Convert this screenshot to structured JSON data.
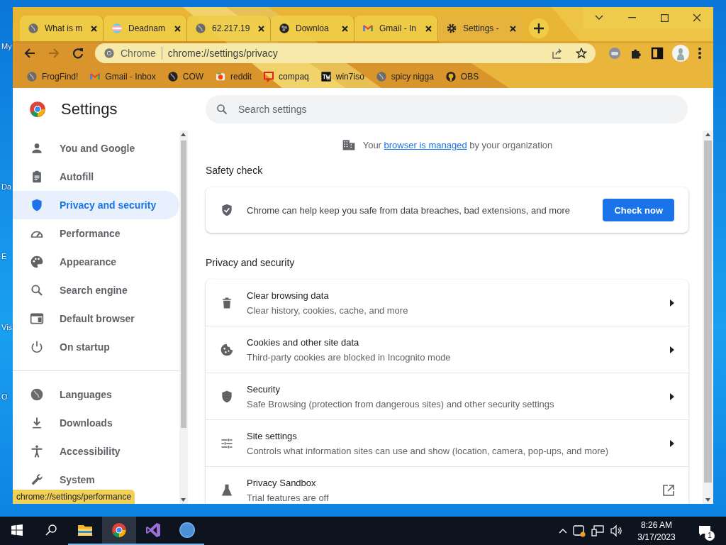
{
  "desktop_icons": [
    {
      "label": "My"
    },
    {
      "label": "Da"
    },
    {
      "label": "E"
    },
    {
      "label": "Vis"
    },
    {
      "label": "O"
    }
  ],
  "tabs": [
    {
      "title": "What is m",
      "kind": "globe",
      "selected": false
    },
    {
      "title": "Deadnam",
      "kind": "flag",
      "selected": false
    },
    {
      "title": "62.217.19",
      "kind": "globe",
      "selected": false
    },
    {
      "title": "Downloa",
      "kind": "obs",
      "selected": false
    },
    {
      "title": "Gmail - In",
      "kind": "gmail",
      "selected": false
    },
    {
      "title": "Settings -",
      "kind": "gear",
      "selected": true
    }
  ],
  "address_bar": {
    "chip": "Chrome",
    "url": "chrome://settings/privacy"
  },
  "bookmarks": [
    {
      "label": "FrogFind!",
      "kind": "globe"
    },
    {
      "label": "Gmail - Inbox",
      "kind": "gmail"
    },
    {
      "label": "COW",
      "kind": "globe-dark"
    },
    {
      "label": "reddit",
      "kind": "reddit"
    },
    {
      "label": "compaq",
      "kind": "compaq"
    },
    {
      "label": "win7iso",
      "kind": "tw"
    },
    {
      "label": "spicy nigga",
      "kind": "globe"
    },
    {
      "label": "OBS",
      "kind": "github"
    }
  ],
  "settings": {
    "title": "Settings",
    "search_placeholder": "Search settings",
    "nav_groups": [
      [
        {
          "label": "You and Google",
          "kind": "person",
          "selected": false
        },
        {
          "label": "Autofill",
          "kind": "clipboard",
          "selected": false
        },
        {
          "label": "Privacy and security",
          "kind": "shield",
          "selected": true
        },
        {
          "label": "Performance",
          "kind": "gauge",
          "selected": false
        },
        {
          "label": "Appearance",
          "kind": "palette",
          "selected": false
        },
        {
          "label": "Search engine",
          "kind": "search",
          "selected": false
        },
        {
          "label": "Default browser",
          "kind": "browser",
          "selected": false
        },
        {
          "label": "On startup",
          "kind": "power",
          "selected": false
        }
      ],
      [
        {
          "label": "Languages",
          "kind": "globe",
          "selected": false
        },
        {
          "label": "Downloads",
          "kind": "download",
          "selected": false
        },
        {
          "label": "Accessibility",
          "kind": "person-arms",
          "selected": false
        },
        {
          "label": "System",
          "kind": "wrench",
          "selected": false
        }
      ]
    ],
    "status_url": "chrome://settings/performance",
    "managed_notice": {
      "before": "Your ",
      "link": "browser is managed",
      "after": " by your organization"
    },
    "safety_check": {
      "heading": "Safety check",
      "text": "Chrome can help keep you safe from data breaches, bad extensions, and more",
      "button": "Check now"
    },
    "privacy": {
      "heading": "Privacy and security",
      "rows": [
        {
          "title": "Clear browsing data",
          "subtitle": "Clear history, cookies, cache, and more",
          "kind": "trash"
        },
        {
          "title": "Cookies and other site data",
          "subtitle": "Third-party cookies are blocked in Incognito mode",
          "kind": "cookie"
        },
        {
          "title": "Security",
          "subtitle": "Safe Browsing (protection from dangerous sites) and other security settings",
          "kind": "shield"
        },
        {
          "title": "Site settings",
          "subtitle": "Controls what information sites can use and show (location, camera, pop-ups, and more)",
          "kind": "sliders"
        },
        {
          "title": "Privacy Sandbox",
          "subtitle": "Trial features are off",
          "kind": "flask"
        }
      ]
    }
  },
  "taskbar": {
    "apps": [
      {
        "kind": "folder",
        "selected": false
      },
      {
        "kind": "chrome",
        "selected": true
      },
      {
        "kind": "vs",
        "selected": false
      },
      {
        "kind": "qb",
        "selected": false
      }
    ],
    "time": "8:26 AM",
    "date": "3/17/2023",
    "notification_count": "1"
  }
}
